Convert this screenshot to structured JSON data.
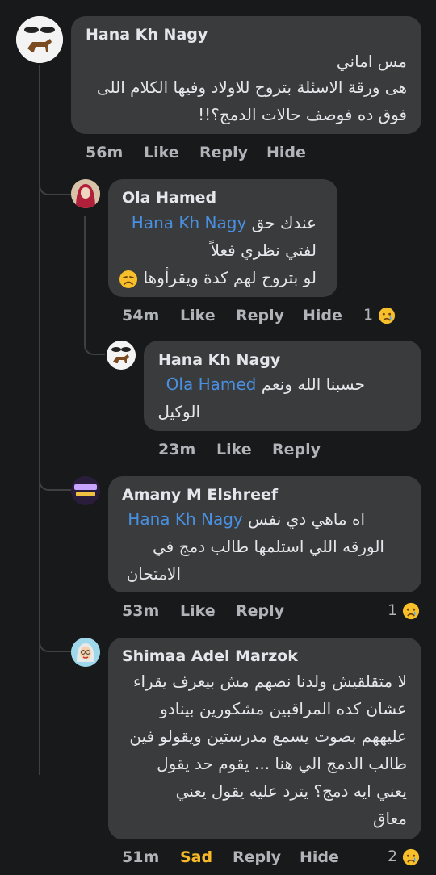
{
  "comments": [
    {
      "author": "Hana Kh Nagy",
      "lines": [
        "مس اماني",
        "هى ورقة الاسئلة بتروح للاولاد وفيها الكلام اللى",
        "فوق ده فوصف حالات الدمج؟!!"
      ],
      "time": "56m",
      "like": "Like",
      "reply": "Reply",
      "hide": "Hide"
    },
    {
      "author": "Ola Hamed",
      "mention": "Hana Kh Nagy",
      "line1_text": "عندك حق",
      "lines": [
        "لفتي نظري فعلاً",
        "لو بتروح لهم كدة ويقرأوها"
      ],
      "time": "54m",
      "like": "Like",
      "reply": "Reply",
      "hide": "Hide",
      "reaction_count": "1",
      "reaction_icon": "crying-face-icon"
    },
    {
      "author": "Hana Kh Nagy",
      "mention": "Ola Hamed",
      "line1_text": "حسبنا الله ونعم",
      "lines": [
        "الوكيل"
      ],
      "time": "23m",
      "like": "Like",
      "reply": "Reply"
    },
    {
      "author": "Amany M Elshreef",
      "mention": "Hana Kh Nagy",
      "line1_text": "اه ماهي دي نفس",
      "lines": [
        "الورقه اللي استلمها طالب دمج في",
        "الامتحان"
      ],
      "time": "53m",
      "like": "Like",
      "reply": "Reply",
      "reaction_count": "1",
      "reaction_icon": "crying-face-icon"
    },
    {
      "author": "Shimaa Adel Marzok",
      "lines": [
        "لا متقلقيش ولدنا نصهم مش بيعرف يقراء",
        "عشان كده المراقبين مشكورين بينادو",
        "عليههم بصوت يسمع مدرستين ويقولو فين",
        "طالب الدمج الي هنا ... يقوم حد يقول",
        "يعني ايه دمج؟ يترد عليه يقول يعني",
        "معاق"
      ],
      "time": "51m",
      "like": "Sad",
      "reply": "Reply",
      "hide": "Hide",
      "reaction_count": "2",
      "reaction_icon": "crying-face-icon"
    }
  ],
  "colors": {
    "background": "#18191a",
    "bubble": "#3a3b3c",
    "mention": "#4a90e2",
    "sad_reaction": "#f7b928"
  }
}
